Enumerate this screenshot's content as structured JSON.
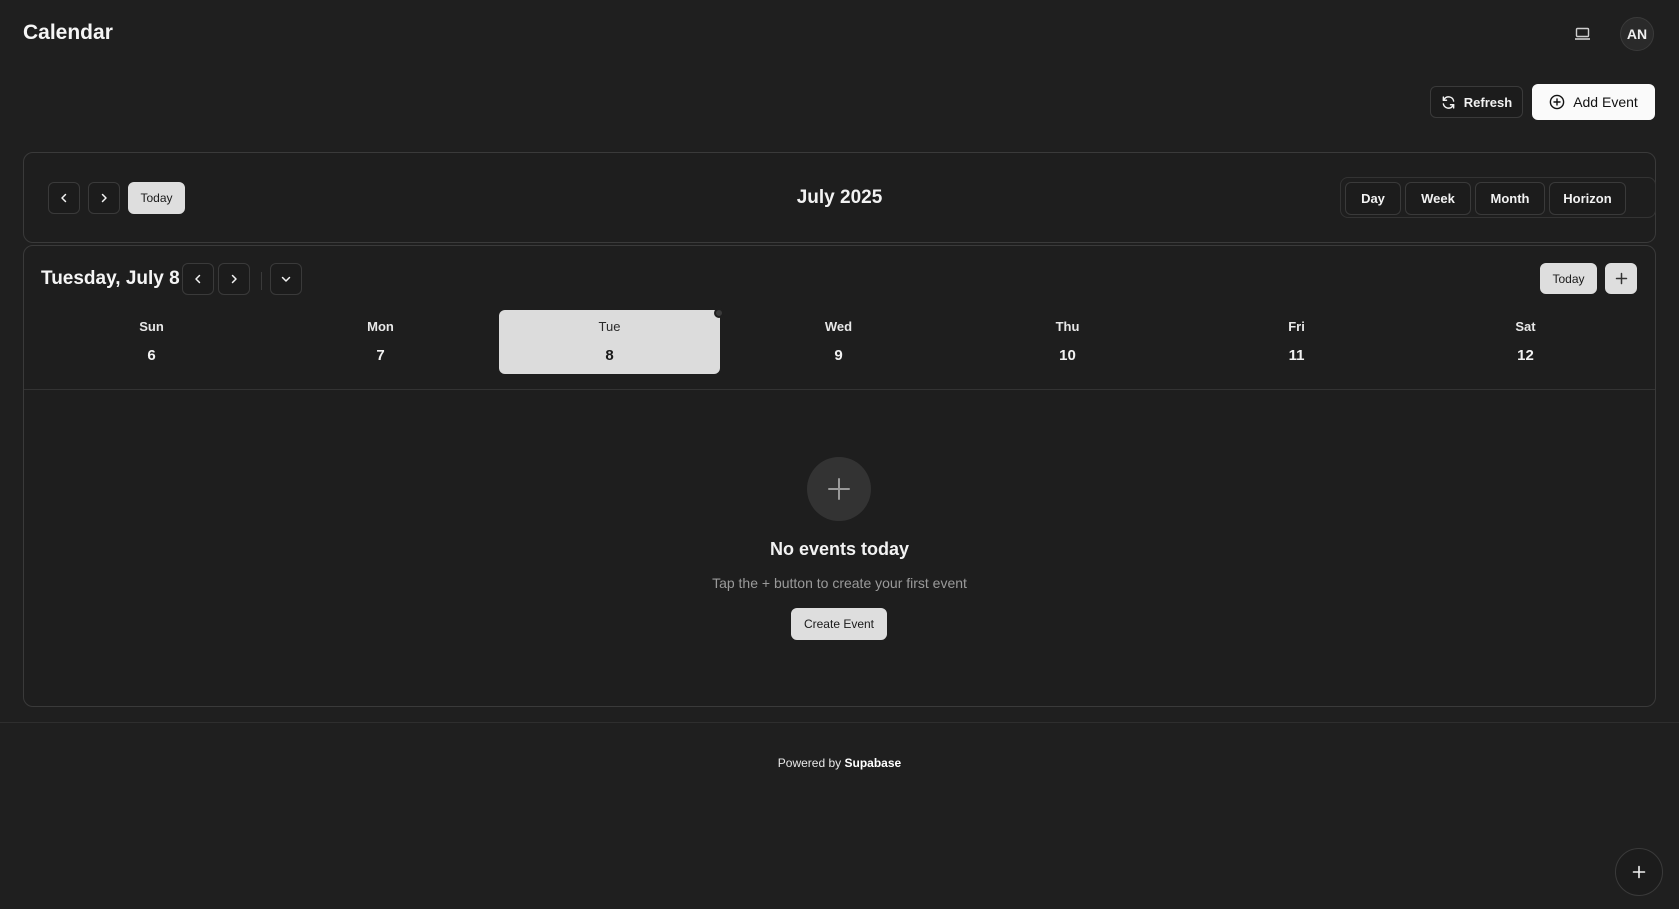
{
  "header": {
    "title": "Calendar",
    "avatar_initials": "AN",
    "device_icon": "laptop-icon"
  },
  "actions": {
    "refresh_label": "Refresh",
    "add_event_label": "Add Event"
  },
  "nav": {
    "today_label": "Today",
    "month_title": "July 2025",
    "views": [
      "Day",
      "Week",
      "Month",
      "Horizon"
    ]
  },
  "day_view": {
    "title": "Tuesday, July 8",
    "today_label": "Today",
    "week": [
      {
        "name": "Sun",
        "num": "6"
      },
      {
        "name": "Mon",
        "num": "7"
      },
      {
        "name": "Tue",
        "num": "8",
        "selected": true
      },
      {
        "name": "Wed",
        "num": "9"
      },
      {
        "name": "Thu",
        "num": "10"
      },
      {
        "name": "Fri",
        "num": "11"
      },
      {
        "name": "Sat",
        "num": "12"
      }
    ],
    "empty": {
      "title": "No events today",
      "subtitle": "Tap the + button to create your first event",
      "button_label": "Create Event"
    }
  },
  "footer": {
    "prefix": "Powered by",
    "brand": "Supabase"
  },
  "colors": {
    "background": "#1f1f1f",
    "border": "#3a3a3a",
    "selected_day": "#dcdcdc",
    "muted_text": "#9a9a9a"
  }
}
